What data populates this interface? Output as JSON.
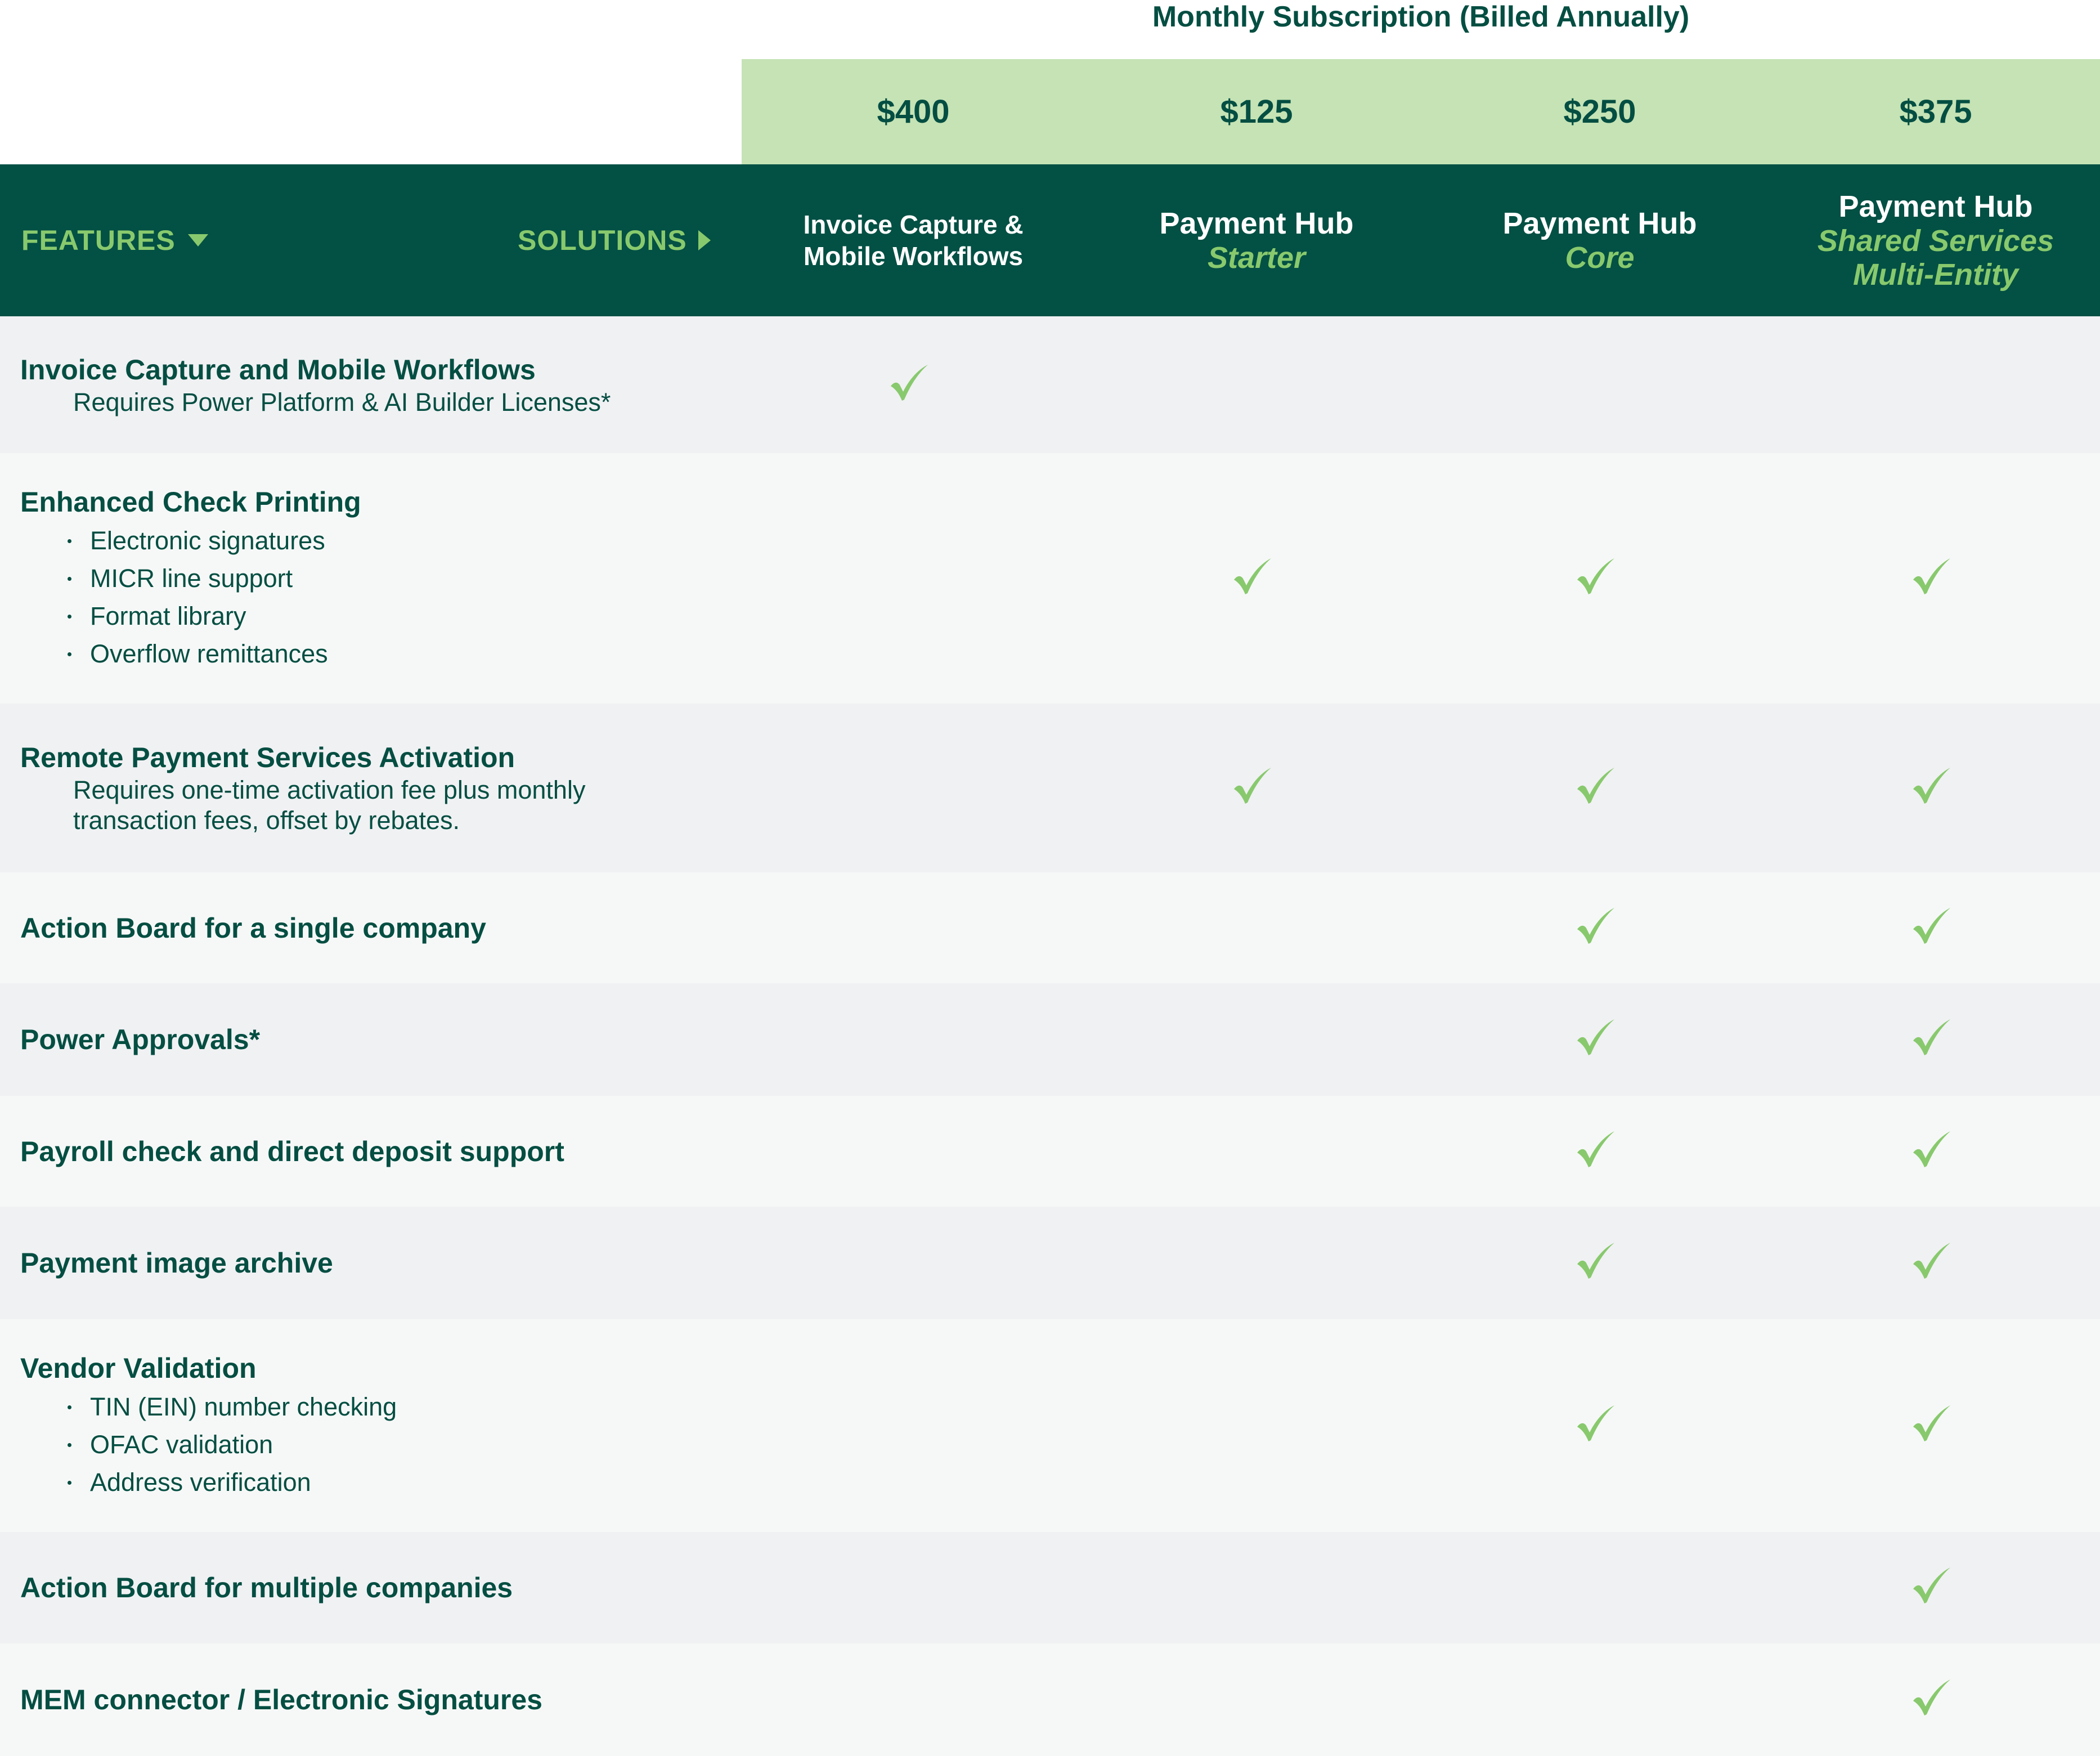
{
  "header": {
    "title": "Monthly Subscription (Billed Annually)",
    "features_label": "FEATURES",
    "solutions_label": "SOLUTIONS"
  },
  "plans": [
    {
      "price": "$400",
      "name_line1": "Invoice Capture &",
      "name_line2": "Mobile Workflows",
      "subtitle": ""
    },
    {
      "price": "$125",
      "name_line1": "Payment Hub",
      "name_line2": "",
      "subtitle": "Starter"
    },
    {
      "price": "$250",
      "name_line1": "Payment Hub",
      "name_line2": "",
      "subtitle": "Core"
    },
    {
      "price": "$375",
      "name_line1": "Payment Hub",
      "name_line2": "",
      "subtitle": "Shared Services",
      "subtitle2": "Multi-Entity"
    }
  ],
  "colors": {
    "dark_green": "#035044",
    "accent_green": "#88c96d",
    "price_band": "#c5e3b5",
    "row_gray": "#f0f1f3",
    "row_light": "#f6f8f7"
  },
  "features": [
    {
      "name": "Invoice Capture and Mobile Workflows",
      "note": [
        "Requires Power Platform & AI Builder Licenses*"
      ],
      "bullets": [],
      "included": [
        true,
        false,
        false,
        false
      ]
    },
    {
      "name": "Enhanced Check Printing",
      "note": [],
      "bullets": [
        "Electronic signatures",
        "MICR line support",
        "Format library",
        "Overflow remittances"
      ],
      "included": [
        false,
        true,
        true,
        true
      ]
    },
    {
      "name": "Remote Payment Services Activation",
      "note": [
        "Requires one-time activation fee plus monthly",
        "transaction fees, offset by rebates."
      ],
      "bullets": [],
      "included": [
        false,
        true,
        true,
        true
      ]
    },
    {
      "name": "Action Board for a single company",
      "note": [],
      "bullets": [],
      "included": [
        false,
        false,
        true,
        true
      ]
    },
    {
      "name": "Power Approvals*",
      "note": [],
      "bullets": [],
      "included": [
        false,
        false,
        true,
        true
      ]
    },
    {
      "name": "Payroll check and direct deposit support",
      "note": [],
      "bullets": [],
      "included": [
        false,
        false,
        true,
        true
      ]
    },
    {
      "name": "Payment image archive",
      "note": [],
      "bullets": [],
      "included": [
        false,
        false,
        true,
        true
      ]
    },
    {
      "name": "Vendor Validation",
      "note": [],
      "bullets": [
        "TIN (EIN) number checking",
        "OFAC validation",
        "Address verification"
      ],
      "included": [
        false,
        false,
        true,
        true
      ]
    },
    {
      "name": "Action Board for multiple companies",
      "note": [],
      "bullets": [],
      "included": [
        false,
        false,
        false,
        true
      ]
    },
    {
      "name": "MEM connector / Electronic Signatures",
      "note": [],
      "bullets": [],
      "included": [
        false,
        false,
        false,
        true
      ]
    }
  ]
}
